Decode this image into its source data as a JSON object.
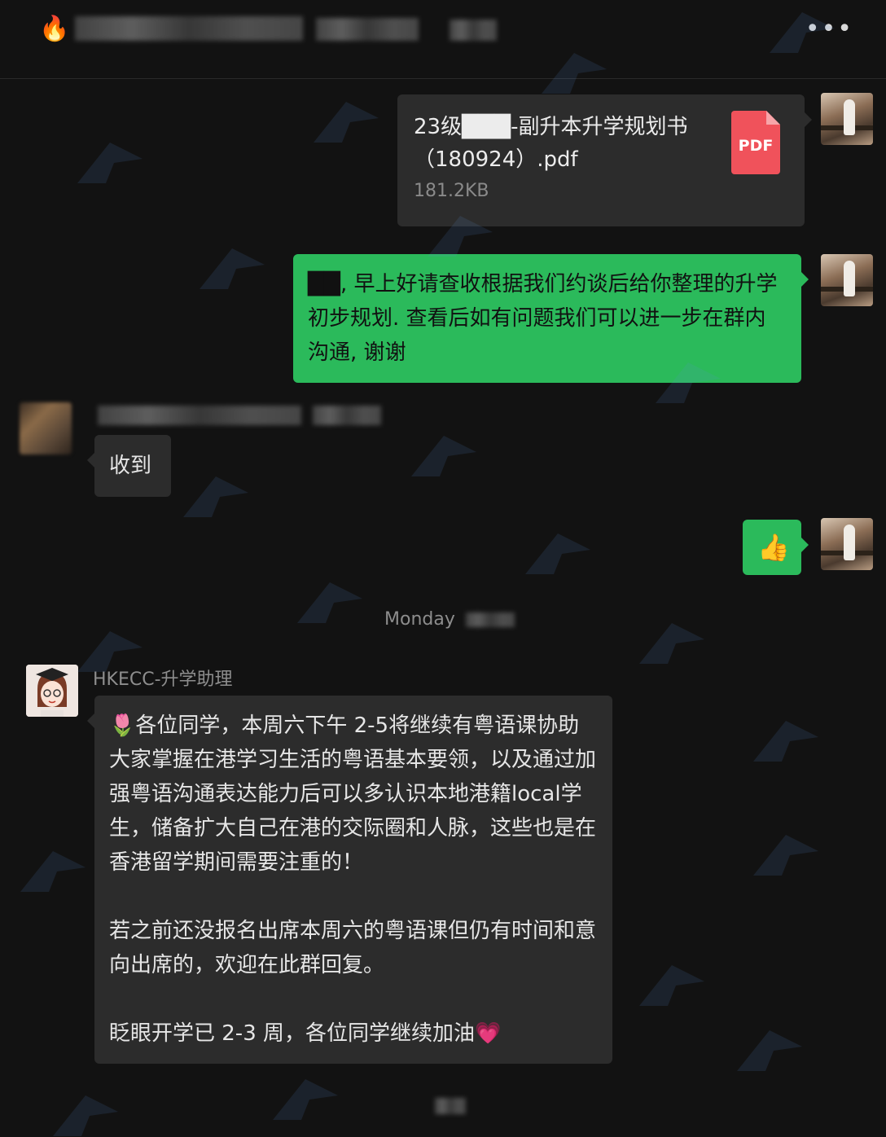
{
  "header": {
    "more_label": "•••"
  },
  "messages": {
    "file": {
      "name": "23级███-副升本升学规划书（180924）.pdf",
      "size": "181.2KB",
      "icon_label": "PDF"
    },
    "green_text": "██, 早上好请查收根据我们约谈后给你整理的升学初步规划. 查看后如有问题我们可以进一步在群内沟通, 谢谢",
    "reply": "收到",
    "thumbs_emoji": "👍",
    "time_divider": "Monday",
    "assistant_name": "HKECC-升学助理",
    "announcement": "🌷各位同学，本周六下午 2-5将继续有粤语课协助大家掌握在港学习生活的粤语基本要领，以及通过加强粤语沟通表达能力后可以多认识本地港籍local学生，储备扩大自己在港的交际圈和人脉，这些也是在香港留学期间需要注重的！\n\n若之前还没报名出席本周六的粤语课但仍有时间和意向出席的，欢迎在此群回复。\n\n眨眼开学已 2-3 周，各位同学继续加油💗"
  },
  "colors": {
    "background": "#121212",
    "bubble_gray": "#2c2c2c",
    "bubble_green": "#2bba5b",
    "pdf_red": "#f0525b"
  }
}
